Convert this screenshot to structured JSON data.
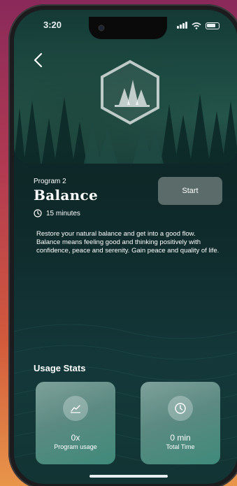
{
  "status_bar": {
    "time": "3:20"
  },
  "program": {
    "number_label": "Program 2",
    "title": "Balance",
    "duration": "15 minutes",
    "start_label": "Start",
    "description": "Restore your natural balance and get into a good flow. Balance means feeling good and thinking positively with confidence, peace and serenity. Gain peace and quality of life."
  },
  "usage": {
    "title": "Usage Stats",
    "cards": [
      {
        "value": "0x",
        "label": "Program usage",
        "icon": "chart-icon"
      },
      {
        "value": "0 min",
        "label": "Total Time",
        "icon": "clock-icon"
      }
    ]
  },
  "colors": {
    "accent_card": "#5b8a82",
    "start_button": "#5b6b6a",
    "background": "#0f2a2a"
  }
}
